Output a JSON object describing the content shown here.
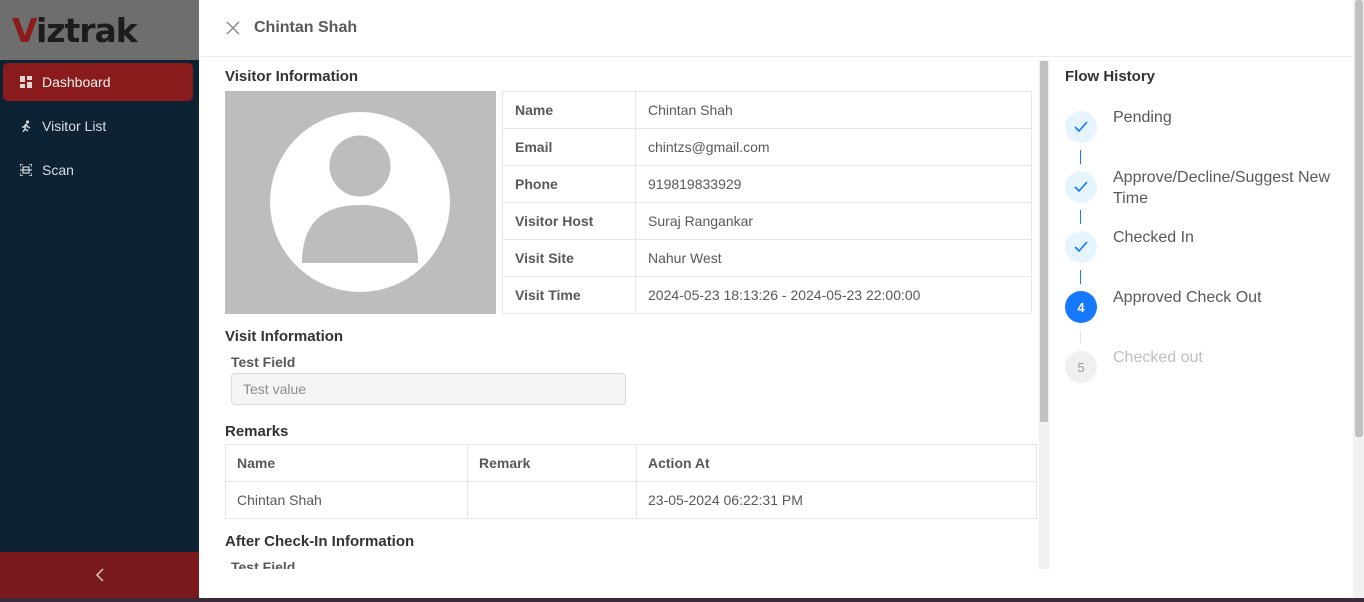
{
  "app": {
    "logo_first": "V",
    "logo_rest": "iztrak"
  },
  "sidebar": {
    "items": [
      {
        "label": "Dashboard",
        "icon": "dashboard-icon",
        "active": true
      },
      {
        "label": "Visitor List",
        "icon": "visitor-list-icon",
        "active": false
      },
      {
        "label": "Scan",
        "icon": "scan-icon",
        "active": false
      }
    ],
    "collapse_icon": "chevron-left-icon"
  },
  "drawer": {
    "title": "Chintan Shah",
    "visitor_info": {
      "title": "Visitor Information",
      "rows": [
        {
          "label": "Name",
          "value": "Chintan Shah"
        },
        {
          "label": "Email",
          "value": "chintzs@gmail.com"
        },
        {
          "label": "Phone",
          "value": "919819833929"
        },
        {
          "label": "Visitor Host",
          "value": "Suraj Rangankar"
        },
        {
          "label": "Visit Site",
          "value": "Nahur West"
        },
        {
          "label": "Visit Time",
          "value": "2024-05-23 18:13:26 - 2024-05-23 22:00:00"
        }
      ]
    },
    "visit_info": {
      "title": "Visit Information",
      "field_label": "Test Field",
      "field_value": "Test value"
    },
    "remarks": {
      "title": "Remarks",
      "columns": [
        "Name",
        "Remark",
        "Action At"
      ],
      "rows": [
        [
          "Chintan Shah",
          "",
          "23-05-2024 06:22:31 PM"
        ]
      ]
    },
    "after_checkin": {
      "title": "After Check-In Information",
      "field_label": "Test Field"
    }
  },
  "flow_history": {
    "title": "Flow History",
    "steps": [
      {
        "label": "Pending",
        "status": "done",
        "number": "1"
      },
      {
        "label": "Approve/Decline/Suggest New Time",
        "status": "done",
        "number": "2"
      },
      {
        "label": "Checked In",
        "status": "done",
        "number": "3"
      },
      {
        "label": "Approved Check Out",
        "status": "current",
        "number": "4"
      },
      {
        "label": "Checked out",
        "status": "wait",
        "number": "5"
      }
    ]
  },
  "colors": {
    "sidebar_bg": "#0d2233",
    "brand_red": "#8a1b1d",
    "primary_blue": "#1677ff"
  }
}
